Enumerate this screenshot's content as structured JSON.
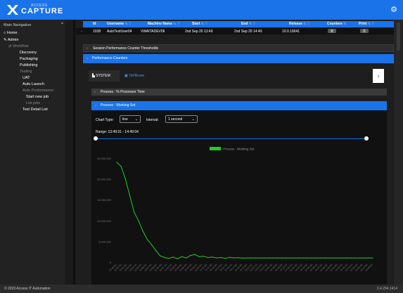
{
  "brand": {
    "small": "ACCESS",
    "big": "CAPTURE"
  },
  "nav": {
    "title": "Main Navigation",
    "items": [
      {
        "label": "Home"
      },
      {
        "label": "Admin"
      },
      {
        "label": "Workflow"
      },
      {
        "label": "Discovery"
      },
      {
        "label": "Packaging"
      },
      {
        "label": "Publishing"
      },
      {
        "label": "Testing"
      },
      {
        "label": "UAT"
      },
      {
        "label": "Auto Launch"
      },
      {
        "label": "Auto Performance"
      },
      {
        "label": "Start new job"
      },
      {
        "label": "List jobs"
      },
      {
        "label": "Test Detail List"
      }
    ]
  },
  "table": {
    "headers": [
      "Id",
      "Username",
      "Machine Name",
      "Start",
      "End",
      "Release",
      "Counters",
      "Print"
    ],
    "row": {
      "id": "1038",
      "username": "AutoTestUser04",
      "machine": "VWAITADEV06",
      "start": "2nd Sep 20 13:49",
      "end": "2nd Sep 20 14:49",
      "release": "10.0.19041"
    }
  },
  "sections": {
    "thresholds": "Session Performance Counter Thresholds",
    "counters": "Performance Counters"
  },
  "tabs": [
    "SYSTEM",
    "7zFM.exe"
  ],
  "subsections": {
    "processor": "Process : % Processor Time",
    "working_set": "Process : Working Set"
  },
  "controls": {
    "chart_type_label": "Chart Type:",
    "chart_type": "line",
    "interval_label": "Interval:",
    "interval": "1 second",
    "range": "Range: 13:49:31 - 14:49:04"
  },
  "chart_data": {
    "type": "line",
    "series": [
      {
        "name": "Process : Working Set",
        "color": "#22cc22",
        "values": [
          24000000,
          23000000,
          20000000,
          16000000,
          12000000,
          10000000,
          7500000,
          5500000,
          4200000,
          2800000,
          1500000,
          1100000,
          900000,
          1200000,
          800000,
          1300000,
          1000000,
          1600000,
          1800000,
          1300000,
          1400000,
          1100000,
          1200000,
          1000000,
          1100000,
          900000,
          1150000,
          1000000,
          1050000,
          950000,
          1000000,
          1000000,
          1000000,
          1000000,
          1000000,
          1000000,
          1000000,
          1000000,
          1000000,
          1000000,
          1000000,
          1000000,
          1000000,
          1000000,
          1000000,
          1000000,
          1000000,
          1000000,
          1000000,
          1000000,
          1000000,
          1000000,
          1000000,
          1000000,
          1000000,
          1000000,
          1000000,
          1000000,
          1000000,
          1000000
        ]
      }
    ],
    "y_ticks": [
      "25,000,000",
      "20,000,000",
      "15,000,000",
      "10,000,000",
      "5,000,000",
      "0"
    ],
    "ylim": [
      0,
      25000000
    ],
    "x_ticks": [
      "13:49:31",
      "13:50:40",
      "13:51:50",
      "13:53:00",
      "13:54:10",
      "13:55:20",
      "13:56:30",
      "13:57:40",
      "13:58:50",
      "14:00:00",
      "14:01:10",
      "14:02:20",
      "14:03:30",
      "14:04:40",
      "14:05:50",
      "14:07:00",
      "14:08:10",
      "14:09:20",
      "14:10:30",
      "14:11:40",
      "14:12:50",
      "14:14:00",
      "14:15:10",
      "14:16:20",
      "14:17:30",
      "14:18:40",
      "14:19:50",
      "14:21:00",
      "14:22:10",
      "14:23:20",
      "14:24:30",
      "14:25:40",
      "14:26:50",
      "14:28:00",
      "14:29:10",
      "14:30:20",
      "14:31:30",
      "14:32:40",
      "14:33:50",
      "14:35:00",
      "14:36:10",
      "14:37:20",
      "14:38:30",
      "14:39:40",
      "14:40:50",
      "14:42:00",
      "14:43:10",
      "14:44:20",
      "14:45:30",
      "14:46:40",
      "14:47:50",
      "14:49:04"
    ],
    "legend": "top-center"
  },
  "footer": {
    "copyright": "© 2023 Access IT Automation",
    "version": "3.4.294.1414"
  }
}
